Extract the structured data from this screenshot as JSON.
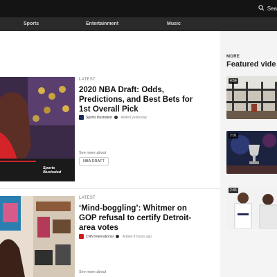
{
  "topbar": {
    "search_label": "Sea"
  },
  "categories": [
    "Sports",
    "Entertainment",
    "Music"
  ],
  "sidebar": {
    "more_label": "MORE",
    "featured_title": "Featured vide",
    "videos": [
      {
        "duration": "4:54"
      },
      {
        "duration": "2:01"
      },
      {
        "duration": "2:45"
      }
    ]
  },
  "articles": [
    {
      "kicker": "LATEST",
      "headline": "2020 NBA Draft: Odds, Predictions, and Best Bets for 1st Overall Pick",
      "source": "Sports Illustrated",
      "added": "Added yesterday",
      "see_more": "See more about",
      "tag": "NBA DRAFT",
      "image_brand": "Sports Illustrated"
    },
    {
      "kicker": "LATEST",
      "headline": "‘Mind-boggling’: Whitmer on GOP refusal to certify Detroit-area votes",
      "source": "CNN International",
      "added": "Added 8 hours ago",
      "see_more": "See more about"
    }
  ]
}
